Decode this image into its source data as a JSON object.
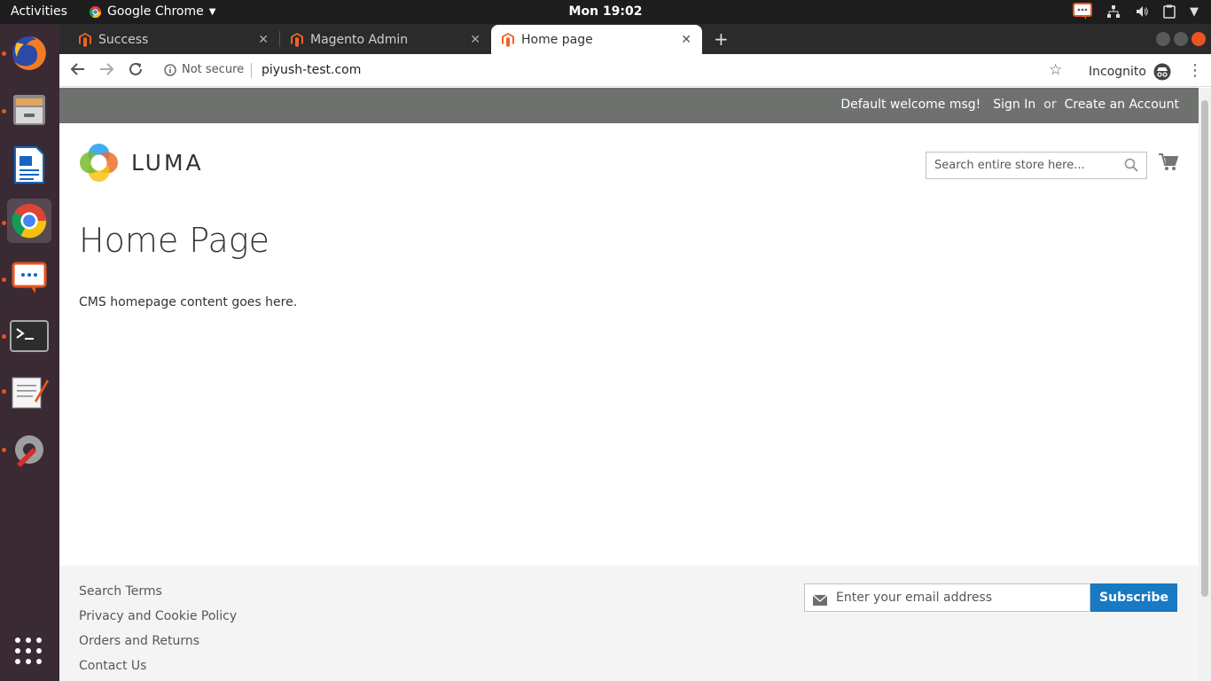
{
  "system": {
    "activities": "Activities",
    "app_name": "Google Chrome",
    "clock": "Mon 19:02"
  },
  "browser": {
    "tabs": [
      {
        "title": "Success"
      },
      {
        "title": "Magento Admin"
      },
      {
        "title": "Home page"
      }
    ],
    "security": "Not secure",
    "url": "piyush-test.com",
    "incognito": "Incognito"
  },
  "store": {
    "welcome": "Default welcome msg!",
    "sign_in": "Sign In",
    "or": "or",
    "create_account": "Create an Account",
    "logo_text": "LUMA",
    "search_placeholder": "Search entire store here...",
    "page_title": "Home Page",
    "content": "CMS homepage content goes here.",
    "footer_links": [
      "Search Terms",
      "Privacy and Cookie Policy",
      "Orders and Returns",
      "Contact Us"
    ],
    "newsletter_placeholder": "Enter your email address",
    "subscribe": "Subscribe"
  },
  "colors": {
    "panel": "#6e716e",
    "accent": "#1979c3",
    "magento": "#f26322",
    "ubuntu_dock": "#3a2a34"
  }
}
